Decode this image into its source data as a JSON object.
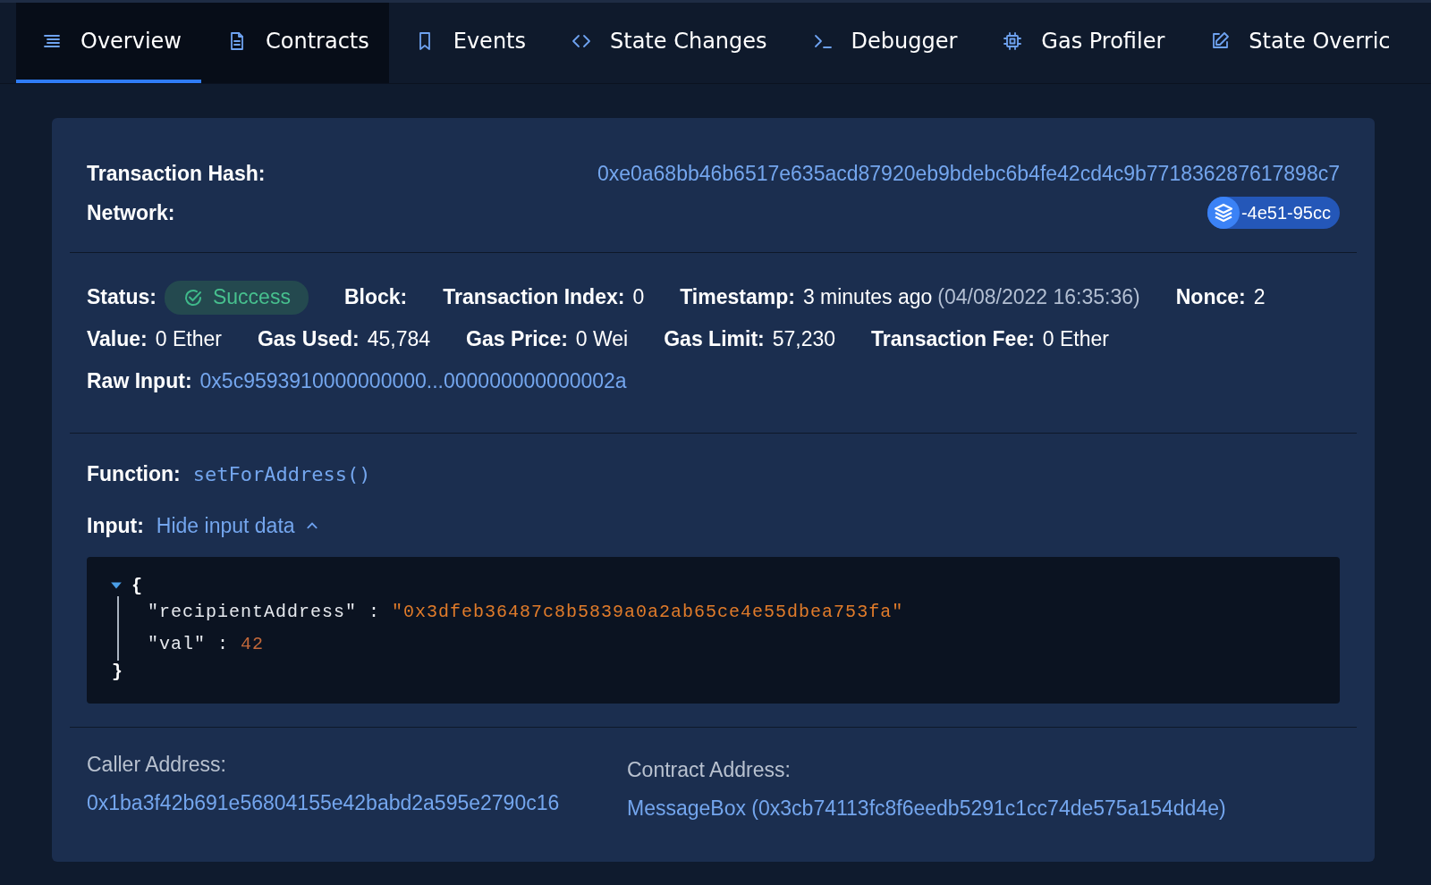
{
  "tabs": [
    {
      "label": "Overview",
      "selected": true,
      "hovered": true
    },
    {
      "label": "Contracts",
      "selected": false,
      "hovered": true
    },
    {
      "label": "Events",
      "selected": false,
      "hovered": false
    },
    {
      "label": "State Changes",
      "selected": false,
      "hovered": false
    },
    {
      "label": "Debugger",
      "selected": false,
      "hovered": false
    },
    {
      "label": "Gas Profiler",
      "selected": false,
      "hovered": false
    },
    {
      "label": "State Overric",
      "selected": false,
      "hovered": false
    }
  ],
  "header": {
    "hash_label": "Transaction Hash:",
    "hash": "0xe0a68bb46b6517e635acd87920eb9bdebc6b4fe42cd4c9b771836287617898c7",
    "network_label": "Network:",
    "network": "-4e51-95cc"
  },
  "details": [
    [
      {
        "label": "Status:",
        "kind": "status",
        "value": "Success"
      },
      {
        "label": "Block:",
        "kind": "text"
      },
      {
        "label": "Transaction Index:",
        "kind": "text",
        "value": "0"
      },
      {
        "label": "Timestamp:",
        "kind": "text",
        "value": "3 minutes ago",
        "note": "(04/08/2022 16:35:36)"
      },
      {
        "label": "Nonce:",
        "kind": "text",
        "value": "2"
      }
    ],
    [
      {
        "label": "Value:",
        "kind": "text",
        "value": "0 Ether"
      },
      {
        "label": "Gas Used:",
        "kind": "text",
        "value": "45,784"
      },
      {
        "label": "Gas Price:",
        "kind": "text",
        "value": "0 Wei"
      },
      {
        "label": "Gas Limit:",
        "kind": "text",
        "value": "57,230"
      },
      {
        "label": "Transaction Fee:",
        "kind": "text",
        "value": "0 Ether"
      }
    ],
    [
      {
        "label": "Raw Input:",
        "kind": "link",
        "value": "0x5c9593910000000000...000000000000002a"
      }
    ]
  ],
  "function": {
    "label": "Function:",
    "value": "setForAddress()"
  },
  "input": {
    "label": "Input:",
    "toggle": "Hide input data",
    "expanded": true
  },
  "input_data": {
    "open_brace": "{",
    "close_brace": "}",
    "collapsed": false,
    "entries": [
      {
        "key": "\"recipientAddress\" :",
        "value": "\"0x3dfeb36487c8b5839a0a2ab65ce4e55dbea753fa\"",
        "kind": "string"
      },
      {
        "key": "\"val\" :",
        "value": "42",
        "kind": "number"
      }
    ]
  },
  "addresses": [
    {
      "label": "Caller Address:",
      "value": "0x1ba3f42b691e56804155e42babd2a595e2790c16"
    },
    {
      "label": "Contract Address:",
      "value": "MessageBox (0x3cb74113fc8f6eedb5291c1cc74de575a154dd4e)"
    }
  ]
}
